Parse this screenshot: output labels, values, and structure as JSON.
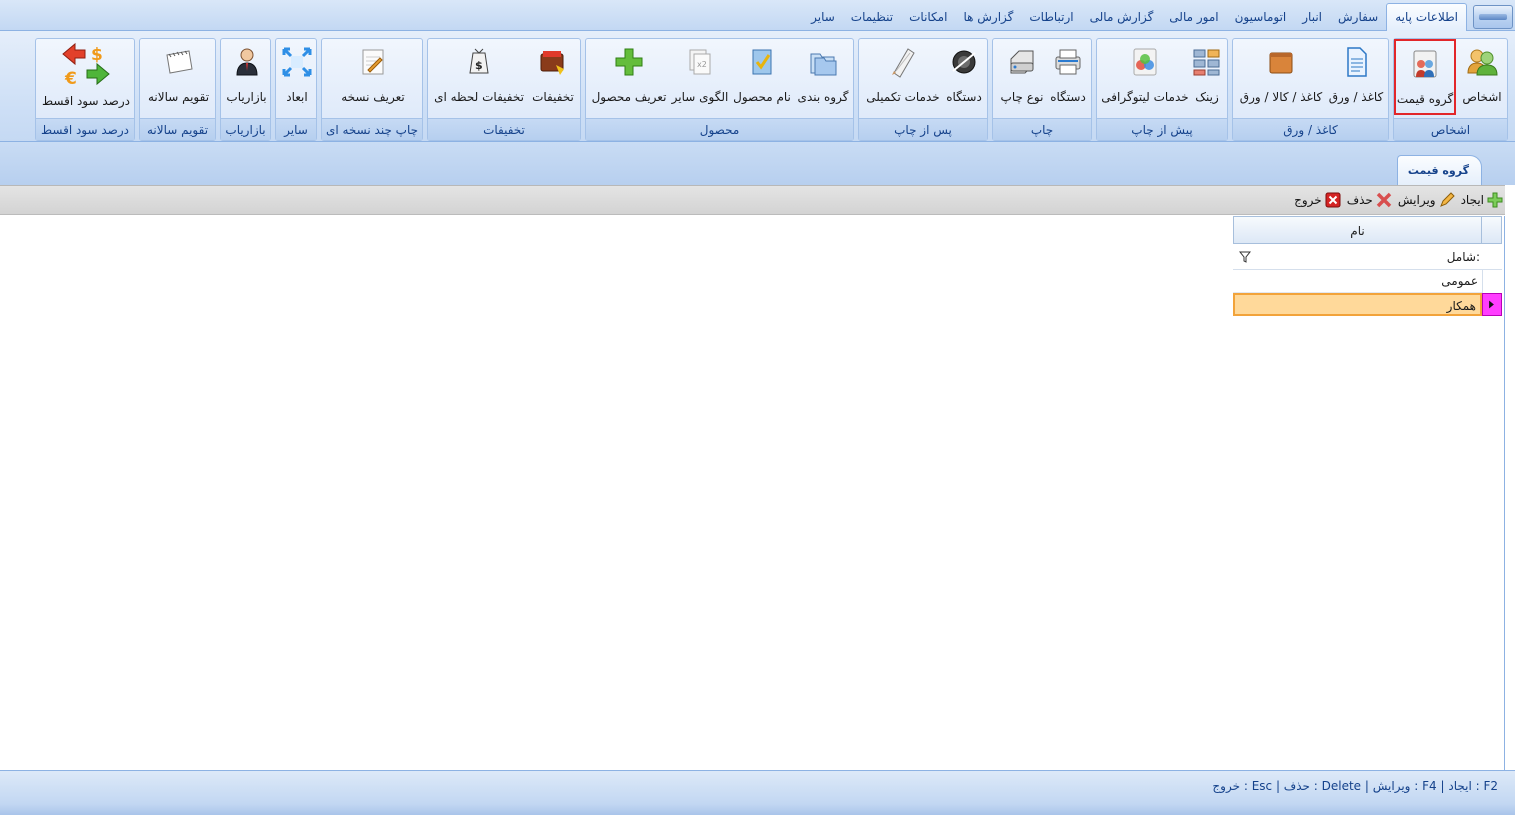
{
  "menu": {
    "tabs": [
      {
        "label": "اطلاعات پایه",
        "active": true
      },
      {
        "label": "سفارش"
      },
      {
        "label": "انبار"
      },
      {
        "label": "اتوماسیون"
      },
      {
        "label": "امور مالی"
      },
      {
        "label": "گزارش مالی"
      },
      {
        "label": "ارتباطات"
      },
      {
        "label": "گزارش ها"
      },
      {
        "label": "امکانات"
      },
      {
        "label": "تنظیمات"
      },
      {
        "label": "سایر"
      }
    ]
  },
  "ribbon": {
    "groups": [
      {
        "title": "اشخاص",
        "buttons": [
          {
            "label": "اشخاص",
            "icon": "people-icon"
          },
          {
            "label": "گروه قیمت",
            "icon": "price-group-icon",
            "selected": true
          }
        ]
      },
      {
        "title": "کاغذ / ورق",
        "buttons": [
          {
            "label": "کاغذ / ورق",
            "icon": "paper-sheet-icon"
          },
          {
            "label": "کاغذ / کالا / ورق",
            "icon": "goods-box-icon"
          }
        ]
      },
      {
        "title": "پیش از چاپ",
        "buttons": [
          {
            "label": "زینک",
            "icon": "zinc-plate-icon"
          },
          {
            "label": "خدمات لیتوگرافی",
            "icon": "lithography-icon"
          }
        ]
      },
      {
        "title": "چاپ",
        "buttons": [
          {
            "label": "دستگاه",
            "icon": "printer-device-icon"
          },
          {
            "label": "نوع چاپ",
            "icon": "print-type-icon"
          }
        ]
      },
      {
        "title": "پس از چاپ",
        "buttons": [
          {
            "label": "دستگاه",
            "icon": "finishing-machine-icon"
          },
          {
            "label": "خدمات تکمیلی",
            "icon": "finishing-services-icon"
          }
        ]
      },
      {
        "title": "محصول",
        "buttons": [
          {
            "label": "گروه بندی",
            "icon": "grouping-folders-icon"
          },
          {
            "label": "نام محصول",
            "icon": "product-name-icon"
          },
          {
            "label": "الگوی سایر",
            "icon": "pattern-icon"
          },
          {
            "label": "تعریف محصول",
            "icon": "add-product-icon"
          }
        ]
      },
      {
        "title": "تخفیفات",
        "buttons": [
          {
            "label": "تخفیفات",
            "icon": "discount-wallet-icon"
          },
          {
            "label": "تخفیفات لحظه ای",
            "icon": "instant-discount-icon"
          }
        ]
      },
      {
        "title": "چاپ چند نسخه ای",
        "buttons": [
          {
            "label": "تعریف نسخه",
            "icon": "edit-copy-icon"
          }
        ]
      },
      {
        "title": "سایر",
        "buttons": [
          {
            "label": "ابعاد",
            "icon": "dimensions-icon"
          }
        ]
      },
      {
        "title": "بازاریاب",
        "buttons": [
          {
            "label": "بازاریاب",
            "icon": "marketer-icon"
          }
        ]
      },
      {
        "title": "تقویم سالانه",
        "buttons": [
          {
            "label": "تقویم سالانه",
            "icon": "calendar-icon"
          }
        ]
      },
      {
        "title": "درصد سود اقسط",
        "buttons": [
          {
            "label": "درصد سود اقسط",
            "icon": "currency-exchange-icon"
          }
        ]
      }
    ]
  },
  "document": {
    "tab_title": "گروه قیمت"
  },
  "toolbar": {
    "create": "ایجاد",
    "edit": "ویرایش",
    "delete": "حذف",
    "exit": "خروج"
  },
  "grid": {
    "column_header": "نام",
    "filter_label": "شامل:",
    "rows": [
      {
        "name": "عمومی"
      },
      {
        "name": "همکار",
        "selected": true
      }
    ]
  },
  "status": {
    "shortcuts": "F2 : ایجاد  |  F4 : ویرایش  |  Delete : حذف  |  Esc : خروج"
  },
  "colors": {
    "ribbon_bg": "#cddff6",
    "selected_row": "#ffd99a",
    "selected_border": "#e2262a",
    "row_indicator": "#ff3dff",
    "text_blue": "#15428b"
  }
}
